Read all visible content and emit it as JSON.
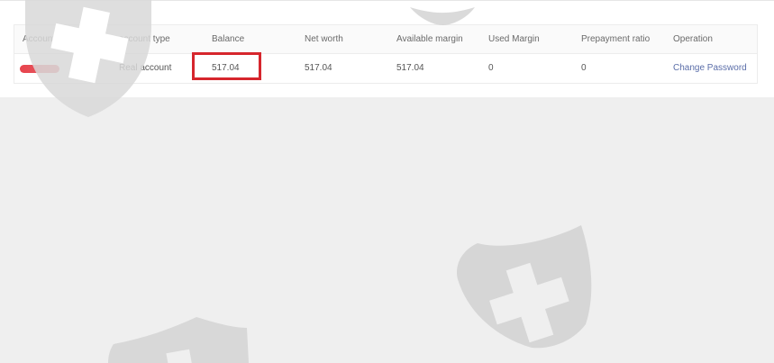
{
  "table": {
    "headers": [
      "Account",
      "account type",
      "Balance",
      "Net worth",
      "Available margin",
      "Used Margin",
      "Prepayment ratio",
      "Operation"
    ],
    "rows": [
      {
        "account": "",
        "account_type": "Real account",
        "balance": "517.04",
        "net_worth": "517.04",
        "available_margin": "517.04",
        "used_margin": "0",
        "prepayment_ratio": "0",
        "operation": "Change Password"
      }
    ]
  },
  "colors": {
    "highlight": "#d6262d",
    "link": "#5b6ea9",
    "redacted": "#e8434c"
  },
  "icons": [
    "shield-cross-watermark-icon"
  ]
}
